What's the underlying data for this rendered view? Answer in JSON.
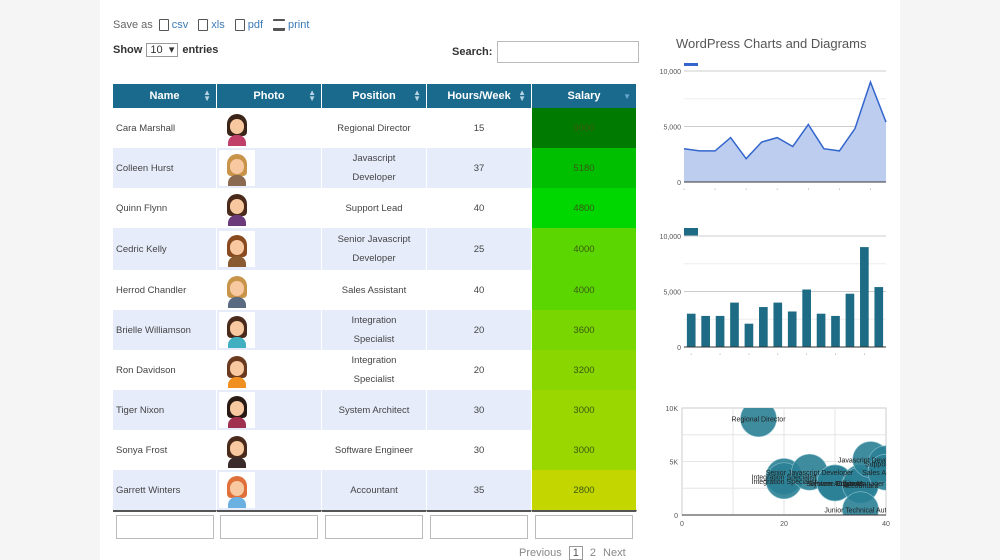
{
  "toolbar": {
    "save_as_label": "Save as",
    "exports": [
      {
        "label": "csv",
        "icon": "csv-file-icon"
      },
      {
        "label": "xls",
        "icon": "xls-file-icon"
      },
      {
        "label": "pdf",
        "icon": "pdf-file-icon"
      },
      {
        "label": "print",
        "icon": "printer-icon"
      }
    ]
  },
  "length": {
    "show_label": "Show",
    "value": "10",
    "entries_label": "entries"
  },
  "search": {
    "label": "Search:",
    "value": ""
  },
  "table": {
    "columns": [
      "Name",
      "Photo",
      "Position",
      "Hours/Week",
      "Salary"
    ],
    "rows": [
      {
        "name": "Cara Marshall",
        "position": "Regional Director",
        "hours": "15",
        "salary": "9000",
        "color": "#007a00",
        "hair": "#3b2418",
        "shirt": "#c0406a"
      },
      {
        "name": "Colleen Hurst",
        "position": "Javascript Developer",
        "hours": "37",
        "salary": "5180",
        "color": "#00bf00",
        "hair": "#c8944a",
        "shirt": "#8a6a50"
      },
      {
        "name": "Quinn Flynn",
        "position": "Support Lead",
        "hours": "40",
        "salary": "4800",
        "color": "#00d600",
        "hair": "#4a2a1a",
        "shirt": "#6a3a7a"
      },
      {
        "name": "Cedric Kelly",
        "position": "Senior Javascript Developer",
        "hours": "25",
        "salary": "4000",
        "color": "#5cd600",
        "hair": "#8a4a20",
        "shirt": "#8a5a30"
      },
      {
        "name": "Herrod Chandler",
        "position": "Sales Assistant",
        "hours": "40",
        "salary": "4000",
        "color": "#5cd600",
        "hair": "#c8944a",
        "shirt": "#5a6a80"
      },
      {
        "name": "Brielle Williamson",
        "position": "Integration Specialist",
        "hours": "20",
        "salary": "3600",
        "color": "#7ad600",
        "hair": "#4a2a1a",
        "shirt": "#40b0c0"
      },
      {
        "name": "Ron Davidson",
        "position": "Integration Specialist",
        "hours": "20",
        "salary": "3200",
        "color": "#8ad600",
        "hair": "#6a3a20",
        "shirt": "#f09020"
      },
      {
        "name": "Tiger Nixon",
        "position": "System Architect",
        "hours": "30",
        "salary": "3000",
        "color": "#9ad600",
        "hair": "#2a1a14",
        "shirt": "#a03050"
      },
      {
        "name": "Sonya Frost",
        "position": "Software Engineer",
        "hours": "30",
        "salary": "3000",
        "color": "#9ad600",
        "hair": "#4a2a1a",
        "shirt": "#3a2a2a"
      },
      {
        "name": "Garrett Winters",
        "position": "Accountant",
        "hours": "35",
        "salary": "2800",
        "color": "#c4d600",
        "hair": "#e0703a",
        "shirt": "#6ab0e0"
      }
    ],
    "footer_filters": [
      "",
      "",
      "",
      "",
      ""
    ]
  },
  "pagination": {
    "previous": "Previous",
    "pages": [
      "1",
      "2"
    ],
    "current": "1",
    "next": "Next"
  },
  "charts_title": "WordPress Charts and Diagrams",
  "chart_data": [
    {
      "type": "area",
      "title": "",
      "series_color": "#3366cc",
      "values": [
        3000,
        2800,
        2800,
        4000,
        2100,
        3600,
        4000,
        3200,
        5180,
        3000,
        2800,
        4800,
        9000,
        5400
      ],
      "ylim": [
        0,
        10000
      ],
      "yticks": [
        "0",
        "5,000",
        "10,000"
      ],
      "grid": true,
      "legend": "top-left"
    },
    {
      "type": "bar",
      "title": "",
      "series_color": "#1e6b85",
      "values": [
        3000,
        2800,
        2800,
        4000,
        2100,
        3600,
        4000,
        3200,
        5180,
        3000,
        2800,
        4800,
        9000,
        5400
      ],
      "ylim": [
        0,
        10000
      ],
      "yticks": [
        "0",
        "5,000",
        "10,000"
      ],
      "grid": true,
      "legend": "top-left"
    },
    {
      "type": "scatter",
      "subtype": "bubble",
      "xlim": [
        0,
        40
      ],
      "ylim": [
        0,
        10000
      ],
      "xticks": [
        "0",
        "20",
        "40"
      ],
      "yticks": [
        "0",
        "5K",
        "10K"
      ],
      "grid": true,
      "points": [
        {
          "label": "Regional Director",
          "x": 15,
          "y": 9000
        },
        {
          "label": "Integration Specialist",
          "x": 20,
          "y": 3600
        },
        {
          "label": "Integration Specialist",
          "x": 20,
          "y": 3200
        },
        {
          "label": "Senior Javascript Developer",
          "x": 25,
          "y": 4000
        },
        {
          "label": "Software Engineer",
          "x": 30,
          "y": 3000
        },
        {
          "label": "System Architect",
          "x": 30,
          "y": 3000
        },
        {
          "label": "Office Manager",
          "x": 35,
          "y": 3000
        },
        {
          "label": "Accountant",
          "x": 35,
          "y": 2800
        },
        {
          "label": "Javascript Developer",
          "x": 37,
          "y": 5180
        },
        {
          "label": "Support Lead",
          "x": 40,
          "y": 4800
        },
        {
          "label": "Sales Assistant",
          "x": 40,
          "y": 4000
        },
        {
          "label": "Junior Technical Author",
          "x": 35,
          "y": 500
        }
      ]
    }
  ]
}
